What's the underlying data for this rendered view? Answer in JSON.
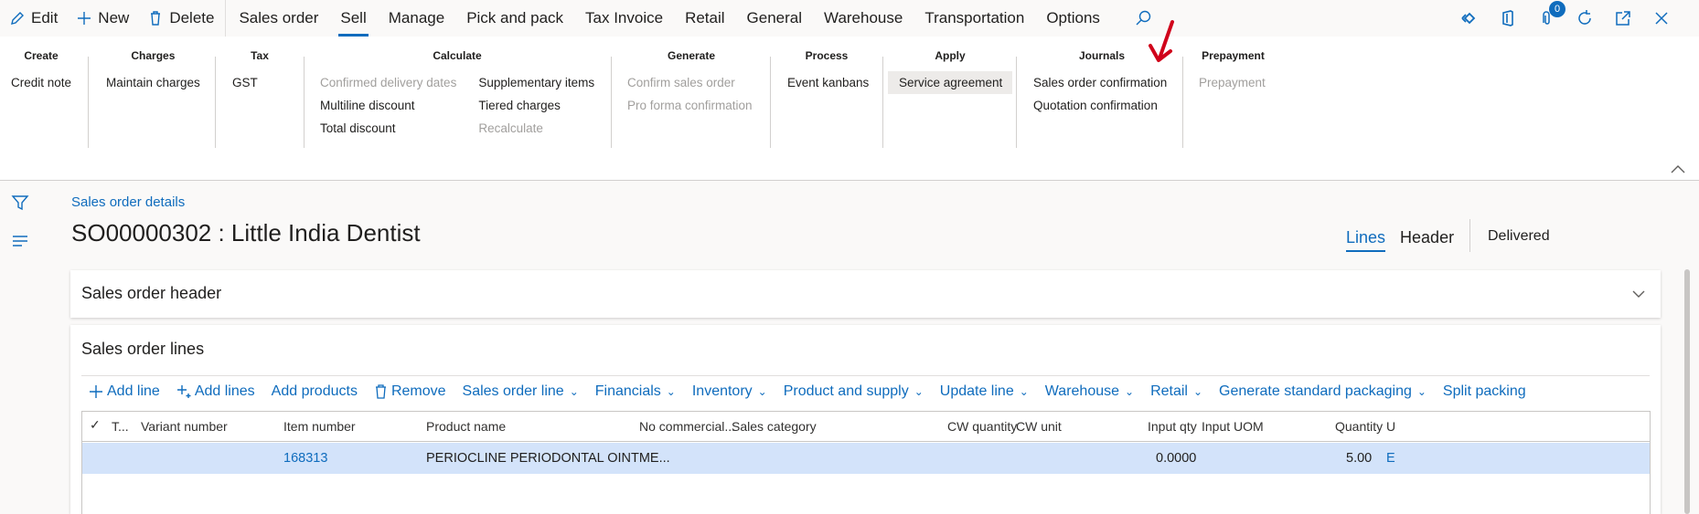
{
  "toolbar": {
    "edit": "Edit",
    "new": "New",
    "delete": "Delete",
    "tabs": [
      "Sales order",
      "Sell",
      "Manage",
      "Pick and pack",
      "Tax Invoice",
      "Retail",
      "General",
      "Warehouse",
      "Transportation",
      "Options"
    ],
    "active_tab": "Sell",
    "notification_count": "0"
  },
  "ribbon": {
    "groups": {
      "create": {
        "title": "Create",
        "items": [
          "Credit note"
        ]
      },
      "charges": {
        "title": "Charges",
        "items": [
          "Maintain charges"
        ]
      },
      "tax": {
        "title": "Tax",
        "items": [
          "GST"
        ]
      },
      "calculate": {
        "title": "Calculate",
        "col1": [
          "Confirmed delivery dates",
          "Multiline discount",
          "Total discount"
        ],
        "col2": [
          "Supplementary items",
          "Tiered charges",
          "Recalculate"
        ]
      },
      "generate": {
        "title": "Generate",
        "items": [
          "Confirm sales order",
          "Pro forma confirmation"
        ]
      },
      "process": {
        "title": "Process",
        "items": [
          "Event kanbans"
        ]
      },
      "apply": {
        "title": "Apply",
        "items": [
          "Service agreement"
        ]
      },
      "journals": {
        "title": "Journals",
        "items": [
          "Sales order confirmation",
          "Quotation confirmation"
        ]
      },
      "prepayment": {
        "title": "Prepayment",
        "items": [
          "Prepayment"
        ]
      }
    }
  },
  "page": {
    "breadcrumb": "Sales order details",
    "title": "SO00000302 : Little India Dentist",
    "view_lines": "Lines",
    "view_header": "Header",
    "status": "Delivered"
  },
  "header_card": {
    "title": "Sales order header"
  },
  "lines_card": {
    "title": "Sales order lines",
    "actions": {
      "add_line": "Add line",
      "add_lines": "Add lines",
      "add_products": "Add products",
      "remove": "Remove",
      "sales_order_line": "Sales order line",
      "financials": "Financials",
      "inventory": "Inventory",
      "product_and_supply": "Product and supply",
      "update_line": "Update line",
      "warehouse": "Warehouse",
      "retail": "Retail",
      "generate_standard_packaging": "Generate standard packaging",
      "split_packing": "Split packing"
    },
    "columns": {
      "type": "T...",
      "variant": "Variant number",
      "item": "Item number",
      "product": "Product name",
      "no_commercial": "No commercial...",
      "category": "Sales category",
      "cw_qty": "CW quantity",
      "cw_unit": "CW unit",
      "input_qty": "Input qty",
      "input_uom": "Input UOM",
      "quantity": "Quantity",
      "unit": "U"
    },
    "rows": [
      {
        "item": "168313",
        "product": "PERIOCLINE PERIODONTAL OINTME...",
        "input_qty": "0.0000",
        "quantity": "5.00",
        "unit": "E"
      }
    ]
  },
  "colors": {
    "accent": "#0f6cbd",
    "selected_row": "#d3e3fa",
    "annotation_arrow": "#d0021b"
  }
}
